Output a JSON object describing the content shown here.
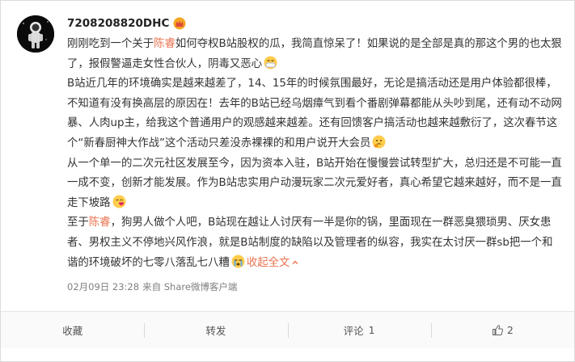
{
  "user": {
    "name": "7208208820DHC"
  },
  "post": {
    "p1": {
      "before": "刚刚吃到一个关于",
      "mention": "陈睿",
      "after": "如何夺权B站股权的瓜，我简直惊呆了！如果说的是全部是真的那这个男的也太狠了，报假警逼走女性合伙人，阴毒又恶心"
    },
    "p2": {
      "text": "B站近几年的环境确实是越来越差了，14、15年的时候氛围最好，无论是搞活动还是用户体验都很棒，不知道有没有换高层的原因在！去年的B站已经乌烟瘴气到看个番剧弹幕都能从头吵到尾，还有动不动网暴、人肉up主，给我这个普通用户的观感越来越差。还有回馈客户搞活动也越来越敷衍了，这次春节这个“新春厨神大作战”这个活动只差没赤裸裸的和用户说开大会员"
    },
    "p3": {
      "text": "从一个单一的二次元社区发展至今，因为资本入驻，B站开始在慢慢尝试转型扩大，总归还是不可能一直一成不变，创新才能发展。作为B站忠实用户动漫玩家二次元爱好者，真心希望它越来越好，而不是一直走下坡路"
    },
    "p4": {
      "before": "至于",
      "mention": "陈睿",
      "after": "，狗男人做个人吧，B站现在越让人讨厌有一半是你的锅，里面现在一群恶臭猥琐男、厌女患者、男权主义不停地兴风作浪，就是B站制度的缺陷以及管理者的纵容，我实在太讨厌一群sb把一个和谐的环境破坏的七零八落乱七八糟",
      "expand": "收起全文"
    }
  },
  "meta": {
    "time": "02月09日 23:28",
    "source": "来自 Share微博客户端"
  },
  "actions": {
    "favorite": "收藏",
    "repost": "转发",
    "comment_label": "评论",
    "comment_count": "1",
    "like_count": "2"
  },
  "colors": {
    "mention": "#eb7350",
    "text": "#333333",
    "meta": "#808080"
  },
  "icons": {
    "crown": "vip-crown-icon",
    "emoji_sick": "sick-face-emoji",
    "emoji_think": "thinking-face-emoji",
    "emoji_kiss": "heart-kiss-emoji",
    "emoji_cry": "crying-face-emoji",
    "expand": "chevron-up-icon",
    "like": "thumbs-up-icon"
  }
}
